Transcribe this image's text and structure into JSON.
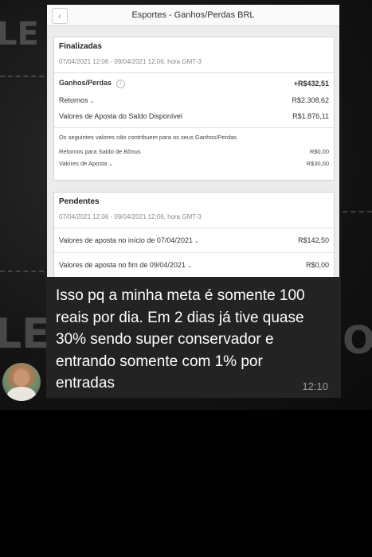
{
  "screenshot": {
    "title": "Esportes - Ganhos/Perdas BRL",
    "back_icon": "chevron-left-icon",
    "settled": {
      "title": "Finalizadas",
      "dates": "07/04/2021 12:06 - 09/04/2021 12:06, hora GMT-3",
      "profit_label": "Ganhos/Perdas",
      "profit_value": "+R$432,51",
      "returns_label": "Retornos",
      "returns_value": "R$2.308,62",
      "stakes_label": "Valores de Aposta do Saldo Disponível",
      "stakes_value": "R$1.876,11",
      "note": "Os seguintes valores não contribuem para os seus Ganhos/Perdas",
      "bonus_label": "Retornos para Saldo de Bônus",
      "bonus_value": "R$0,00",
      "bet_values_label": "Valores de Aposta",
      "bet_values_value": "R$30,00"
    },
    "pending": {
      "title": "Pendentes",
      "dates": "07/04/2021 12:06 - 09/04/2021 12:06, hora GMT-3",
      "start_label": "Valores de aposta no início de 07/04/2021",
      "start_value": "R$142,50",
      "end_label": "Valores de aposta no fim de 09/04/2021",
      "end_value": "R$0,00"
    }
  },
  "message": {
    "text": "Isso pq a minha meta é somente 100 reais por dia. Em 2 dias já tive quase 30% sendo super conservador e entrando somente com 1% por entradas",
    "time": "12:10",
    "avatar": "user-avatar"
  },
  "colors": {
    "bubble": "#232323",
    "background": "#000000",
    "profit": "#222222"
  }
}
